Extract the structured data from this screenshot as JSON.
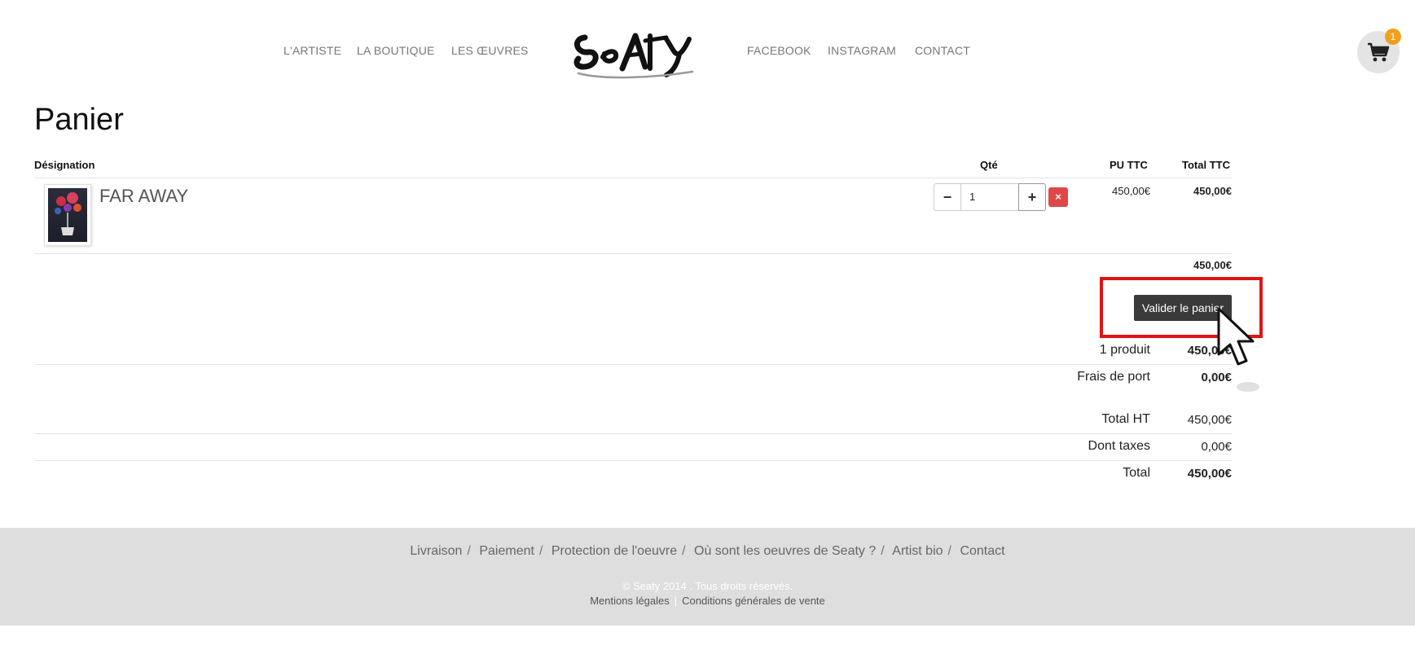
{
  "header": {
    "nav_left": [
      "L'ARTISTE",
      "LA BOUTIQUE",
      "LES ŒUVRES"
    ],
    "nav_right": [
      "FACEBOOK",
      "INSTAGRAM",
      "CONTACT"
    ],
    "logo_text": "Seaty",
    "cart_count": "1"
  },
  "page": {
    "title": "Panier"
  },
  "table": {
    "headers": {
      "designation": "Désignation",
      "qty": "Qté",
      "pu": "PU TTC",
      "total": "Total TTC"
    },
    "rows": [
      {
        "name": "FAR AWAY",
        "qty": "1",
        "unit_price": "450,00€",
        "total": "450,00€"
      }
    ],
    "subtotal": "450,00€",
    "remove_label": "×",
    "minus_label": "−",
    "plus_label": "+"
  },
  "actions": {
    "validate_label": "Valider le panier"
  },
  "summary": {
    "products_label": "1 produit",
    "products_value": "450,00€",
    "shipping_label": "Frais de port",
    "shipping_value": "0,00€",
    "total_ht_label": "Total HT",
    "total_ht_value": "450,00€",
    "taxes_label": "Dont taxes",
    "taxes_value": "0,00€",
    "total_label": "Total",
    "total_value": "450,00€"
  },
  "footer": {
    "links": [
      "Livraison",
      "Paiement",
      "Protection de l'oeuvre",
      "Où sont les oeuvres de Seaty ?",
      "Artist bio",
      "Contact"
    ],
    "copyright": "© Seaty 2014 . Tous droits réservés.",
    "legal": [
      "Mentions légales",
      "Conditions générales de vente"
    ]
  },
  "colors": {
    "remove": "#e04848",
    "badge": "#f0a020",
    "highlight": "#e01414",
    "button": "#3a3a3a"
  }
}
